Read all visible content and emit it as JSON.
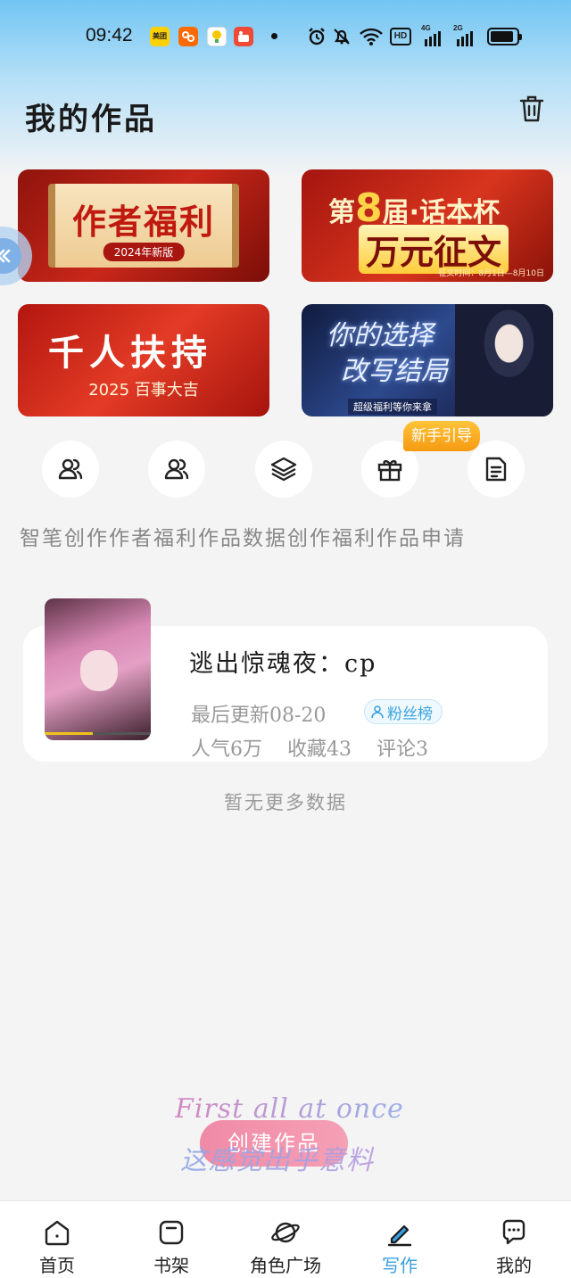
{
  "status_bar": {
    "time": "09:42",
    "apps": [
      {
        "name": "meituan-icon",
        "label": "美团",
        "color": "#ffd100"
      },
      {
        "name": "taobao-icon",
        "label": "",
        "color": "#ff6a00"
      },
      {
        "name": "bulb-app-icon",
        "label": "",
        "color": "#ffffff"
      },
      {
        "name": "red-app-icon",
        "label": "",
        "color": "#ef4a36"
      }
    ],
    "hd": "HD",
    "net1": "4G",
    "net2": "2G"
  },
  "header": {
    "title": "我的作品"
  },
  "banners": [
    {
      "title": "作者福利",
      "subtitle": "2024年新版"
    },
    {
      "line1_prefix": "第",
      "line1_num": "8",
      "line1_suffix": "届",
      "line1_name": "话本杯",
      "line2": "万元征文",
      "line3": "征文时间：8月1日—8月10日"
    },
    {
      "title": "千人扶持",
      "subtitle": "2025 百事大吉"
    },
    {
      "title_line1": "你的选择",
      "title_line2": "改写结局",
      "subtitle": "超级福利等你来拿"
    }
  ],
  "shortcuts": {
    "guide_badge": "新手引导",
    "labels_text": "智笔创作作者福利作品数据创作福利作品申请",
    "items": [
      {
        "name": "smart-pen-shortcut",
        "icon": "users-icon"
      },
      {
        "name": "author-welfare-shortcut",
        "icon": "users-icon"
      },
      {
        "name": "works-data-shortcut",
        "icon": "layers-icon"
      },
      {
        "name": "creation-welfare-shortcut",
        "icon": "gift-icon"
      },
      {
        "name": "works-apply-shortcut",
        "icon": "document-icon"
      }
    ]
  },
  "work": {
    "title": "逃出惊魂夜：cp",
    "updated": "最后更新08-20",
    "fans_tag": "粉丝榜",
    "popularity": "人气6万",
    "favorites": "收藏43",
    "comments": "评论3"
  },
  "no_more": "暂无更多数据",
  "create_button": "创建作品",
  "floating_text": {
    "en": "First all at once",
    "zh": "这感觉出乎意料"
  },
  "bottom_nav": [
    {
      "label": "首页",
      "icon": "home-icon"
    },
    {
      "label": "书架",
      "icon": "bookshelf-icon"
    },
    {
      "label": "角色广场",
      "icon": "planet-icon"
    },
    {
      "label": "写作",
      "icon": "pen-icon",
      "active": true
    },
    {
      "label": "我的",
      "icon": "chat-bubble-icon"
    }
  ],
  "colors": {
    "accent": "#3aa0e0",
    "guide_badge": "#f6a61b",
    "create_button": "#f08aa6"
  }
}
